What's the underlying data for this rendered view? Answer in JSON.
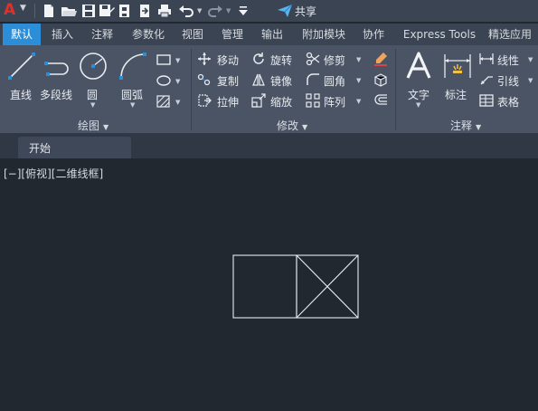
{
  "app": {
    "logo_letter": "A"
  },
  "quick_access": {
    "share_label": "共享"
  },
  "tabs": [
    {
      "label": "默认",
      "active": true
    },
    {
      "label": "插入"
    },
    {
      "label": "注释"
    },
    {
      "label": "参数化"
    },
    {
      "label": "视图"
    },
    {
      "label": "管理"
    },
    {
      "label": "输出"
    },
    {
      "label": "附加模块"
    },
    {
      "label": "协作"
    },
    {
      "label": "Express Tools"
    },
    {
      "label": "精选应用"
    }
  ],
  "ribbon": {
    "draw": {
      "title": "绘图",
      "line": "直线",
      "polyline": "多段线",
      "circle": "圆",
      "arc": "圆弧"
    },
    "modify": {
      "title": "修改",
      "move": "移动",
      "rotate": "旋转",
      "trim": "修剪",
      "copy": "复制",
      "mirror": "镜像",
      "fillet": "圆角",
      "stretch": "拉伸",
      "scale": "缩放",
      "array": "阵列"
    },
    "annotation": {
      "title": "注释",
      "text": "文字",
      "dimension": "标注",
      "linear": "线性",
      "leader": "引线",
      "table": "表格"
    }
  },
  "document_tab": {
    "label": "开始"
  },
  "viewport": {
    "label": "[−][俯视][二维线框]"
  },
  "colors": {
    "accent": "#2c8ed8",
    "canvas": "#212830",
    "ribbon": "#4a5465",
    "logo": "#e0302b"
  }
}
